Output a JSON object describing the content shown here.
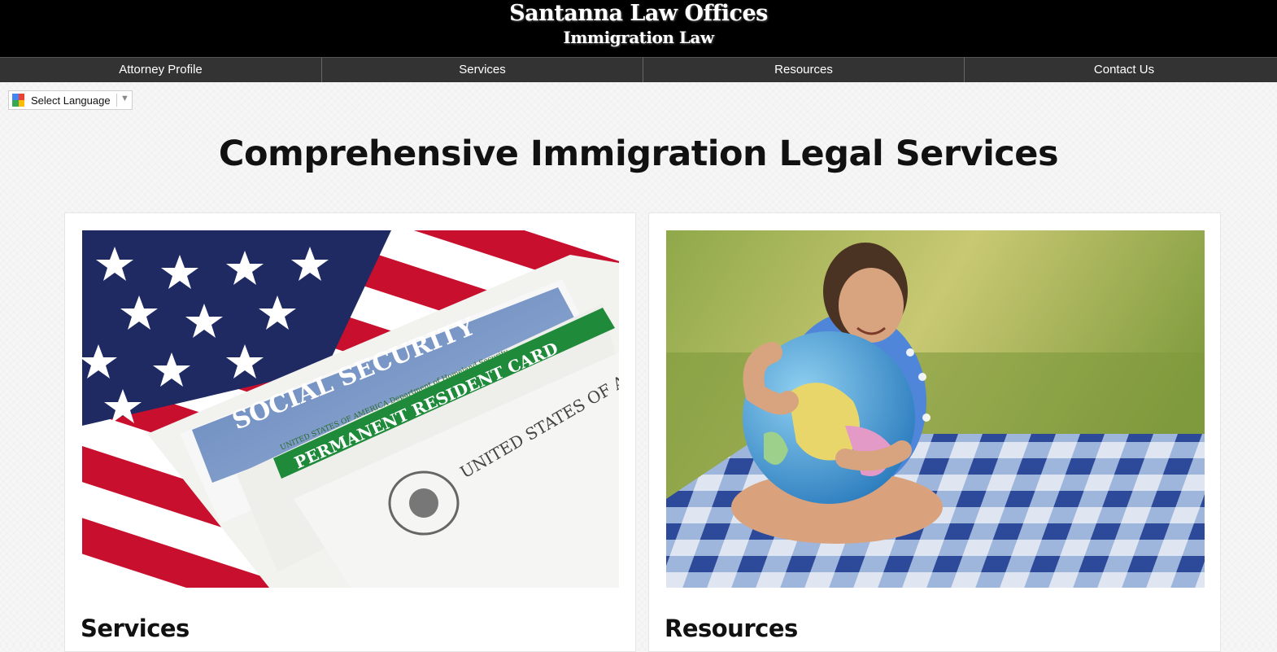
{
  "header": {
    "title": "Santanna Law Offices",
    "subtitle": "Immigration Law"
  },
  "nav": {
    "items": [
      {
        "label": "Attorney Profile"
      },
      {
        "label": "Services"
      },
      {
        "label": "Resources"
      },
      {
        "label": "Contact Us"
      }
    ]
  },
  "language_select": {
    "label": "Select Language",
    "arrow": "▼"
  },
  "main": {
    "heading": "Comprehensive Immigration Legal Services",
    "cards": [
      {
        "title": "Services",
        "image_text": {
          "social_security": "SOCIAL SECURITY",
          "dhs_line": "UNITED STATES OF AMERICA  Department of Homeland Security",
          "green_card": "PERMANENT RESIDENT CARD",
          "passport": "UNITED STATES OF A"
        }
      },
      {
        "title": "Resources"
      }
    ]
  },
  "colors": {
    "header_bg": "#000000",
    "nav_bg": "#333333",
    "page_bg": "#f6f6f6"
  }
}
